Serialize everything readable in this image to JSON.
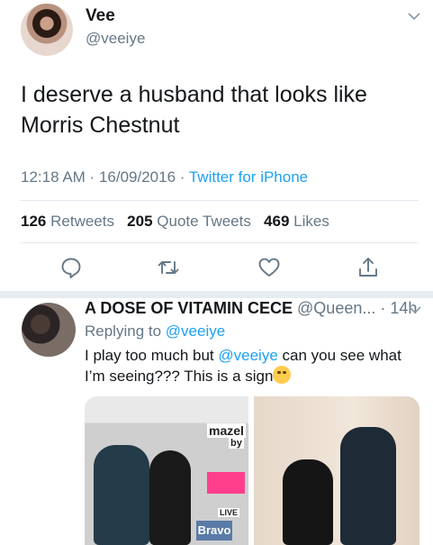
{
  "tweet": {
    "author_name": "Vee",
    "author_handle": "@veeiye",
    "text": "I deserve a husband that looks like Morris Chestnut",
    "time": "12:18 AM",
    "date": "16/09/2016",
    "source": "Twitter for iPhone",
    "retweets_count": "126",
    "retweets_label": "Retweets",
    "quotes_count": "205",
    "quotes_label": "Quote Tweets",
    "likes_count": "469",
    "likes_label": "Likes",
    "actions": [
      "reply-icon",
      "retweet-icon",
      "like-icon",
      "share-icon"
    ]
  },
  "reply": {
    "author_name": "A DOSE OF VITAMIN CECE",
    "author_handle": "@Queen...",
    "time": "14h",
    "replying_label": "Replying to",
    "replying_handle": "@veeiye",
    "text_before": "I play too much but",
    "mention": "@veeiye",
    "text_after": "can you see what I’m seeing??? This is a sign",
    "photo_texts": {
      "mazel": "mazel",
      "by": "by",
      "live": "LIVE",
      "bravo": "Bravo"
    }
  },
  "colors": {
    "accent": "#1da1f2",
    "muted": "#657786",
    "divider": "#e1e8ed"
  }
}
